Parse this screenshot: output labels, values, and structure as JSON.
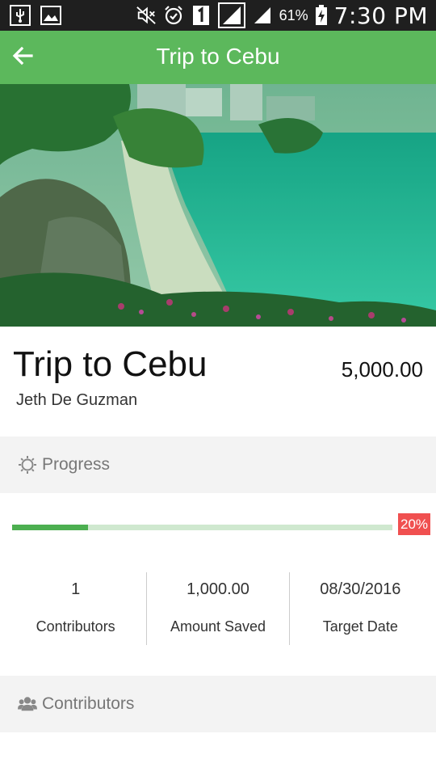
{
  "status_bar": {
    "left_icons": [
      "usb-icon",
      "image-icon"
    ],
    "right_icons": [
      "mute-icon",
      "alarm-icon",
      "sim-1-icon",
      "signal-strong-icon",
      "signal-icon",
      "battery-charging-icon"
    ],
    "battery": "61%",
    "time": "7:30 PM"
  },
  "app_bar": {
    "back_icon": "arrow-left-icon",
    "title": "Trip to Cebu",
    "color": "#5cb85c"
  },
  "goal": {
    "title": "Trip to Cebu",
    "owner": "Jeth De Guzman",
    "amount": "5,000.00"
  },
  "progress_section": {
    "icon": "sun-icon",
    "label": "Progress",
    "percent_label": "20%",
    "fraction": 0.2,
    "fill_color": "#4caf50",
    "badge_color": "#f05050"
  },
  "stats": [
    {
      "value": "1",
      "label": "Contributors"
    },
    {
      "value": "1,000.00",
      "label": "Amount Saved"
    },
    {
      "value": "08/30/2016",
      "label": "Target Date"
    }
  ],
  "contributors_section": {
    "icon": "users-icon",
    "label": "Contributors"
  }
}
